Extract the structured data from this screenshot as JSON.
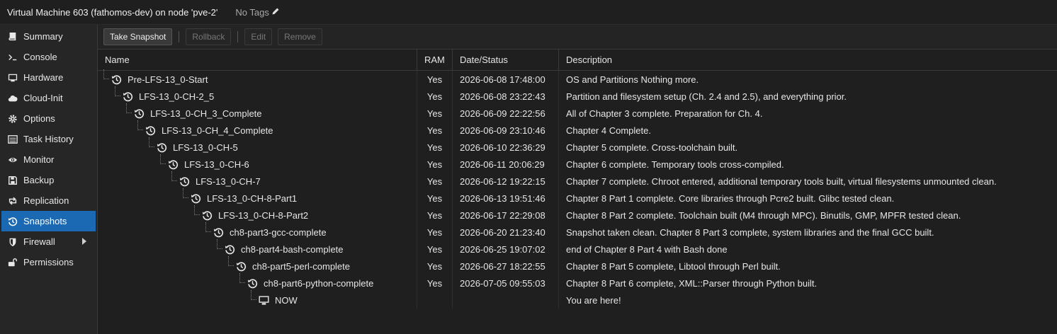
{
  "header": {
    "vm_title": "Virtual Machine 603 (fathomos-dev) on node 'pve-2'",
    "tags_label": "No Tags"
  },
  "sidebar": {
    "items": [
      {
        "label": "Summary",
        "icon": "book-icon"
      },
      {
        "label": "Console",
        "icon": "terminal-icon"
      },
      {
        "label": "Hardware",
        "icon": "monitor-icon"
      },
      {
        "label": "Cloud-Init",
        "icon": "cloud-icon"
      },
      {
        "label": "Options",
        "icon": "gear-icon"
      },
      {
        "label": "Task History",
        "icon": "list-icon"
      },
      {
        "label": "Monitor",
        "icon": "eye-icon"
      },
      {
        "label": "Backup",
        "icon": "floppy-icon"
      },
      {
        "label": "Replication",
        "icon": "retweet-icon"
      },
      {
        "label": "Snapshots",
        "icon": "history-icon",
        "active": true
      },
      {
        "label": "Firewall",
        "icon": "shield-icon",
        "has_submenu": true
      },
      {
        "label": "Permissions",
        "icon": "unlock-icon"
      }
    ]
  },
  "toolbar": {
    "take_snapshot": "Take Snapshot",
    "rollback": "Rollback",
    "edit": "Edit",
    "remove": "Remove"
  },
  "grid": {
    "columns": [
      "Name",
      "RAM",
      "Date/Status",
      "Description"
    ],
    "rows": [
      {
        "name": "Pre-LFS-13_0-Start",
        "ram": "Yes",
        "date": "2026-06-08 17:48:00",
        "desc": "OS and Partitions Nothing more."
      },
      {
        "name": "LFS-13_0-CH-2_5",
        "ram": "Yes",
        "date": "2026-06-08 23:22:43",
        "desc": "Partition and filesystem setup (Ch. 2.4 and 2.5), and everything prior."
      },
      {
        "name": "LFS-13_0-CH_3_Complete",
        "ram": "Yes",
        "date": "2026-06-09 22:22:56",
        "desc": "All of Chapter 3 complete. Preparation for Ch. 4."
      },
      {
        "name": "LFS-13_0-CH_4_Complete",
        "ram": "Yes",
        "date": "2026-06-09 23:10:46",
        "desc": "Chapter 4 Complete."
      },
      {
        "name": "LFS-13_0-CH-5",
        "ram": "Yes",
        "date": "2026-06-10 22:36:29",
        "desc": "Chapter 5 complete. Cross-toolchain built."
      },
      {
        "name": "LFS-13_0-CH-6",
        "ram": "Yes",
        "date": "2026-06-11 20:06:29",
        "desc": "Chapter 6 complete. Temporary tools cross-compiled."
      },
      {
        "name": "LFS-13_0-CH-7",
        "ram": "Yes",
        "date": "2026-06-12 19:22:15",
        "desc": "Chapter 7 complete. Chroot entered, additional temporary tools built, virtual filesystems unmounted clean."
      },
      {
        "name": "LFS-13_0-CH-8-Part1",
        "ram": "Yes",
        "date": "2026-06-13 19:51:46",
        "desc": "Chapter 8 Part 1 complete. Core libraries through Pcre2 built. Glibc tested clean."
      },
      {
        "name": "LFS-13_0-CH-8-Part2",
        "ram": "Yes",
        "date": "2026-06-17 22:29:08",
        "desc": "Chapter 8 Part 2 complete. Toolchain built (M4 through MPC). Binutils, GMP, MPFR tested clean."
      },
      {
        "name": "ch8-part3-gcc-complete",
        "ram": "Yes",
        "date": "2026-06-20 21:23:40",
        "desc": "Snapshot taken clean. Chapter 8 Part 3 complete, system libraries and the final GCC built."
      },
      {
        "name": "ch8-part4-bash-complete",
        "ram": "Yes",
        "date": "2026-06-25 19:07:02",
        "desc": "end of Chapter 8 Part 4 with Bash done"
      },
      {
        "name": "ch8-part5-perl-complete",
        "ram": "Yes",
        "date": "2026-06-27 18:22:55",
        "desc": "Chapter 8 Part 5 complete, Libtool through Perl built."
      },
      {
        "name": "ch8-part6-python-complete",
        "ram": "Yes",
        "date": "2026-07-05 09:55:03",
        "desc": "Chapter 8 Part 6 complete, XML::Parser through Python built."
      },
      {
        "name": "NOW",
        "ram": "",
        "date": "",
        "desc": "You are here!",
        "is_current": true
      }
    ]
  }
}
